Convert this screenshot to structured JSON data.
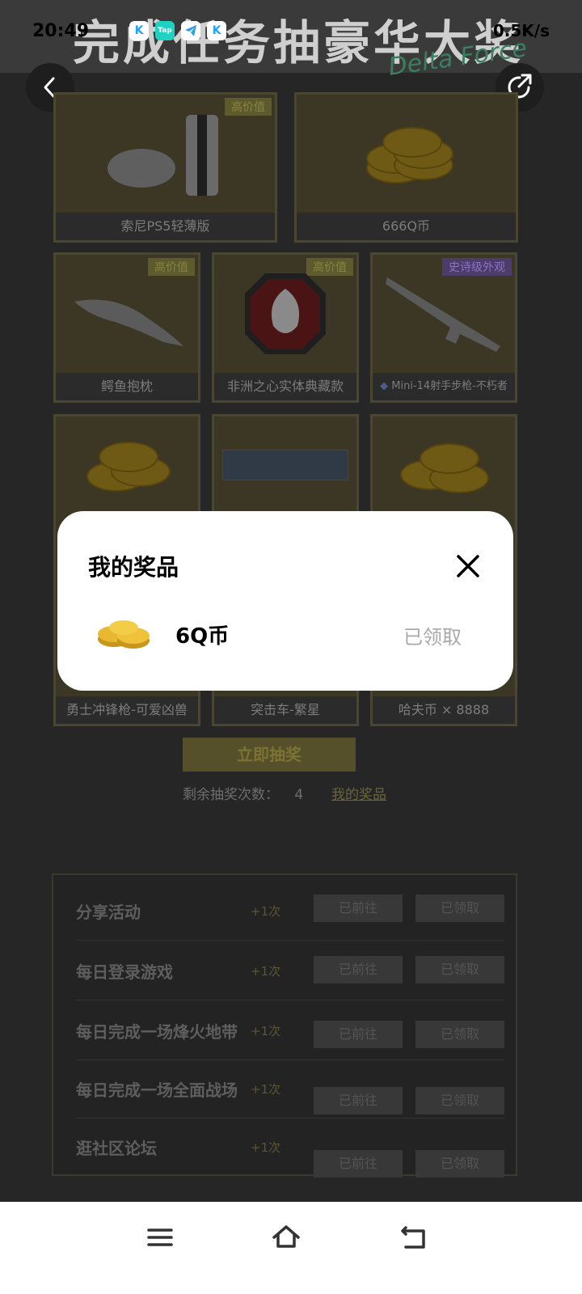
{
  "status_bar": {
    "time": "20:49",
    "right_text": "0.5K/s",
    "apps": [
      "K",
      "Tap",
      "tg",
      "K"
    ]
  },
  "banner": {
    "title": "完成任务抽豪华大奖",
    "subtitle": "Delta Force"
  },
  "header": {
    "back_icon": "chevron-left-icon",
    "share_icon": "share-icon"
  },
  "prizes": [
    {
      "name": "索尼PS5轻薄版",
      "tag": "高价值"
    },
    {
      "name": "666Q币",
      "tag": ""
    },
    {
      "name": "鳄鱼抱枕",
      "tag": "高价值"
    },
    {
      "name": "非洲之心实体典藏款",
      "tag": "高价值"
    },
    {
      "name": "Mini-14射手步枪-不朽者",
      "tag": "史诗级外观"
    },
    {
      "name": "勇士冲锋枪-可爱凶兽",
      "tag": ""
    },
    {
      "name": "突击车-繁星",
      "tag": ""
    },
    {
      "name": "哈夫币 × 8888",
      "tag": ""
    }
  ],
  "draw": {
    "button_label": "立即抽奖",
    "remaining_label": "剩余抽奖次数：",
    "remaining_count": "4",
    "my_prizes_link": "我的奖品"
  },
  "tasks": [
    {
      "name": "分享活动",
      "bonus": "+1次",
      "go": "已前往",
      "claim": "已领取"
    },
    {
      "name": "每日登录游戏",
      "bonus": "+1次",
      "go": "已前往",
      "claim": "已领取"
    },
    {
      "name": "每日完成一场烽火地带",
      "bonus": "+1次",
      "go": "已前往",
      "claim": "已领取"
    },
    {
      "name": "每日完成一场全面战场",
      "bonus": "+1次",
      "go": "已前往",
      "claim": "已领取"
    },
    {
      "name": "逛社区论坛",
      "bonus": "+1次",
      "go": "已前往",
      "claim": "已领取"
    }
  ],
  "modal": {
    "title": "我的奖品",
    "close_icon": "close-icon",
    "items": [
      {
        "name": "6Q币",
        "status": "已领取",
        "icon": "gold-coins-icon"
      }
    ]
  },
  "nav": {
    "menu_icon": "menu-icon",
    "home_icon": "home-icon",
    "back_icon": "back-icon"
  },
  "colors": {
    "accent_yellow": "#d4c14a",
    "modal_bg": "#ffffff",
    "claimed_gray": "#a9a9a9"
  }
}
